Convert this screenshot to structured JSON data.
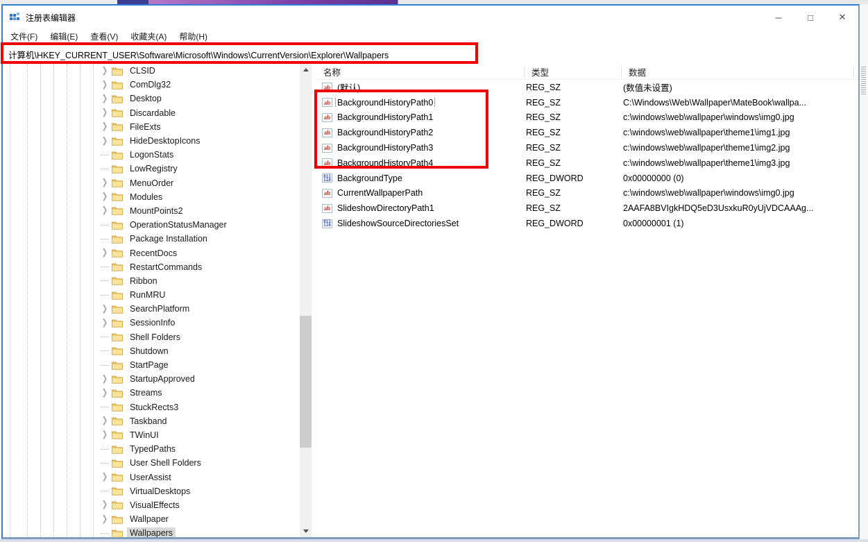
{
  "window": {
    "title": "注册表编辑器",
    "controls": {
      "minimize": "─",
      "maximize": "□",
      "close": "✕"
    }
  },
  "menu": {
    "items": [
      "文件(F)",
      "编辑(E)",
      "查看(V)",
      "收藏夹(A)",
      "帮助(H)"
    ]
  },
  "address": {
    "value": "计算机\\HKEY_CURRENT_USER\\Software\\Microsoft\\Windows\\CurrentVersion\\Explorer\\Wallpapers"
  },
  "tree": {
    "items": [
      {
        "label": "CLSID",
        "expandable": true,
        "selected": false
      },
      {
        "label": "ComDlg32",
        "expandable": true,
        "selected": false
      },
      {
        "label": "Desktop",
        "expandable": true,
        "selected": false
      },
      {
        "label": "Discardable",
        "expandable": true,
        "selected": false
      },
      {
        "label": "FileExts",
        "expandable": true,
        "selected": false
      },
      {
        "label": "HideDesktopIcons",
        "expandable": true,
        "selected": false
      },
      {
        "label": "LogonStats",
        "expandable": false,
        "selected": false
      },
      {
        "label": "LowRegistry",
        "expandable": false,
        "selected": false
      },
      {
        "label": "MenuOrder",
        "expandable": true,
        "selected": false
      },
      {
        "label": "Modules",
        "expandable": true,
        "selected": false
      },
      {
        "label": "MountPoints2",
        "expandable": true,
        "selected": false
      },
      {
        "label": "OperationStatusManager",
        "expandable": false,
        "selected": false
      },
      {
        "label": "Package Installation",
        "expandable": false,
        "selected": false
      },
      {
        "label": "RecentDocs",
        "expandable": true,
        "selected": false
      },
      {
        "label": "RestartCommands",
        "expandable": false,
        "selected": false
      },
      {
        "label": "Ribbon",
        "expandable": false,
        "selected": false
      },
      {
        "label": "RunMRU",
        "expandable": false,
        "selected": false
      },
      {
        "label": "SearchPlatform",
        "expandable": true,
        "selected": false
      },
      {
        "label": "SessionInfo",
        "expandable": true,
        "selected": false
      },
      {
        "label": "Shell Folders",
        "expandable": false,
        "selected": false
      },
      {
        "label": "Shutdown",
        "expandable": false,
        "selected": false
      },
      {
        "label": "StartPage",
        "expandable": false,
        "selected": false
      },
      {
        "label": "StartupApproved",
        "expandable": true,
        "selected": false
      },
      {
        "label": "Streams",
        "expandable": true,
        "selected": false
      },
      {
        "label": "StuckRects3",
        "expandable": false,
        "selected": false
      },
      {
        "label": "Taskband",
        "expandable": true,
        "selected": false
      },
      {
        "label": "TWinUI",
        "expandable": true,
        "selected": false
      },
      {
        "label": "TypedPaths",
        "expandable": false,
        "selected": false
      },
      {
        "label": "User Shell Folders",
        "expandable": false,
        "selected": false
      },
      {
        "label": "UserAssist",
        "expandable": true,
        "selected": false
      },
      {
        "label": "VirtualDesktops",
        "expandable": false,
        "selected": false
      },
      {
        "label": "VisualEffects",
        "expandable": true,
        "selected": false
      },
      {
        "label": "Wallpaper",
        "expandable": true,
        "selected": false
      },
      {
        "label": "Wallpapers",
        "expandable": false,
        "selected": true
      }
    ]
  },
  "list": {
    "columns": [
      "名称",
      "类型",
      "数据"
    ],
    "rows": [
      {
        "icon": "string-value-icon",
        "name": "(默认)",
        "type": "REG_SZ",
        "data": "(数值未设置)",
        "focused": false
      },
      {
        "icon": "string-value-icon",
        "name": "BackgroundHistoryPath0",
        "type": "REG_SZ",
        "data": "C:\\Windows\\Web\\Wallpaper\\MateBook\\wallpa...",
        "focused": true
      },
      {
        "icon": "string-value-icon",
        "name": "BackgroundHistoryPath1",
        "type": "REG_SZ",
        "data": "c:\\windows\\web\\wallpaper\\windows\\img0.jpg",
        "focused": false
      },
      {
        "icon": "string-value-icon",
        "name": "BackgroundHistoryPath2",
        "type": "REG_SZ",
        "data": "c:\\windows\\web\\wallpaper\\theme1\\img1.jpg",
        "focused": false
      },
      {
        "icon": "string-value-icon",
        "name": "BackgroundHistoryPath3",
        "type": "REG_SZ",
        "data": "c:\\windows\\web\\wallpaper\\theme1\\img2.jpg",
        "focused": false
      },
      {
        "icon": "string-value-icon",
        "name": "BackgroundHistoryPath4",
        "type": "REG_SZ",
        "data": "c:\\windows\\web\\wallpaper\\theme1\\img3.jpg",
        "focused": false
      },
      {
        "icon": "dword-value-icon",
        "name": "BackgroundType",
        "type": "REG_DWORD",
        "data": "0x00000000 (0)",
        "focused": false
      },
      {
        "icon": "string-value-icon",
        "name": "CurrentWallpaperPath",
        "type": "REG_SZ",
        "data": "c:\\windows\\web\\wallpaper\\windows\\img0.jpg",
        "focused": false
      },
      {
        "icon": "string-value-icon",
        "name": "SlideshowDirectoryPath1",
        "type": "REG_SZ",
        "data": "2AAFA8BVIgkHDQ5eD3UsxkuR0yUjVDCAAAg...",
        "focused": false
      },
      {
        "icon": "dword-value-icon",
        "name": "SlideshowSourceDirectoriesSet",
        "type": "REG_DWORD",
        "data": "0x00000001 (1)",
        "focused": false
      }
    ]
  },
  "colors": {
    "annotation_red": "#ee0000",
    "window_border_active": "#2e7ed2",
    "window_border_muted": "#7e9cc0",
    "selection_gray": "#d9d9d9",
    "string_icon_red": "#c0392b",
    "dword_icon_blue": "#2d4bd4"
  }
}
